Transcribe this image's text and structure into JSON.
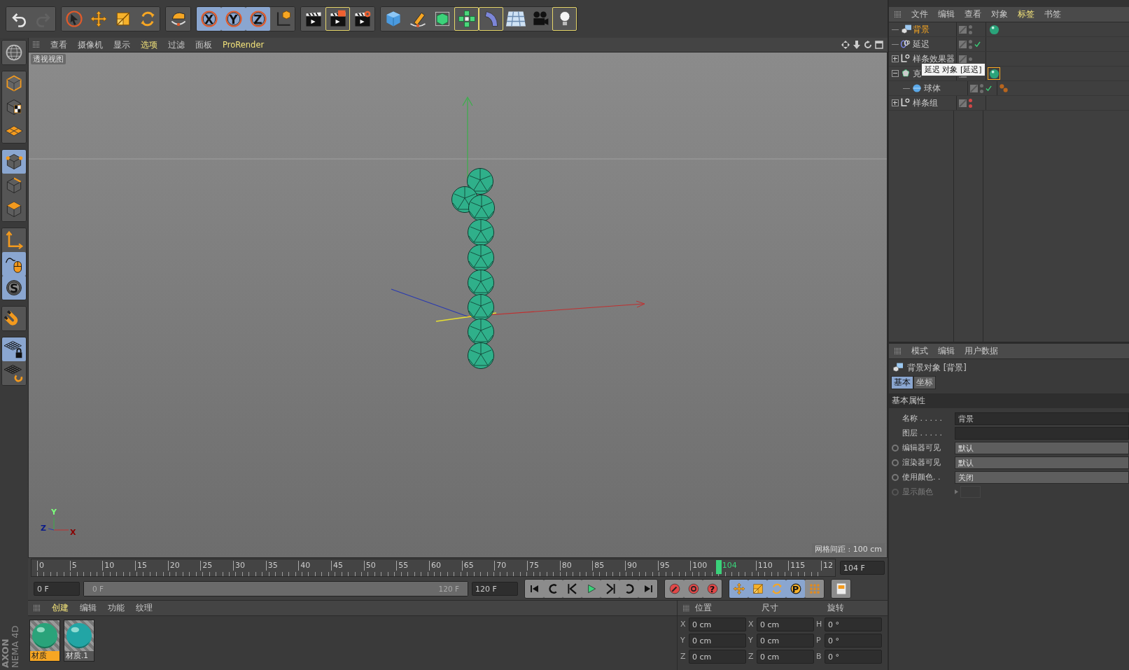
{
  "top_toolbar": [
    [
      {
        "active": false,
        "outlined": false,
        "disabled": false
      },
      {
        "active": false,
        "outlined": false,
        "disabled": true
      }
    ],
    [
      {
        "active": false,
        "outlined": false
      },
      {
        "active": false,
        "outlined": false
      },
      {
        "active": false,
        "outlined": false
      },
      {
        "active": false,
        "outlined": false
      }
    ],
    [
      {
        "active": false,
        "outlined": false
      }
    ],
    [
      {
        "active": true,
        "outlined": false,
        "label": "X"
      },
      {
        "active": true,
        "outlined": false,
        "label": "Y"
      },
      {
        "active": true,
        "outlined": false,
        "label": "Z"
      },
      {
        "active": false,
        "outlined": false
      }
    ],
    [
      {
        "active": false,
        "outlined": false
      },
      {
        "active": false,
        "outlined": true
      },
      {
        "active": false,
        "outlined": false
      }
    ],
    [
      {
        "active": false,
        "outlined": false
      },
      {
        "active": false,
        "outlined": false
      },
      {
        "active": false,
        "outlined": false
      },
      {
        "active": false,
        "outlined": true
      },
      {
        "active": false,
        "outlined": true
      },
      {
        "active": false,
        "outlined": false
      },
      {
        "active": false,
        "outlined": false
      },
      {
        "active": false,
        "outlined": true
      }
    ]
  ],
  "left_toolbar": [
    [
      {
        "active": false
      }
    ],
    [
      {
        "active": false
      },
      {
        "active": false
      },
      {
        "active": false
      }
    ],
    [
      {
        "active": true
      },
      {
        "active": false
      },
      {
        "active": false
      }
    ],
    [
      {
        "active": false
      },
      {
        "active": true
      },
      {
        "active": true,
        "label": "S"
      }
    ],
    [
      {
        "active": false
      }
    ],
    [
      {
        "active": true
      },
      {
        "active": false
      }
    ]
  ],
  "brand": [
    "AXON",
    "NEMA 4D"
  ],
  "viewport": {
    "menu": [
      {
        "label": "查看",
        "highlight": false
      },
      {
        "label": "摄像机",
        "highlight": false
      },
      {
        "label": "显示",
        "highlight": false
      },
      {
        "label": "选项",
        "highlight": true
      },
      {
        "label": "过滤",
        "highlight": false
      },
      {
        "label": "面板",
        "highlight": false
      },
      {
        "label": "ProRender",
        "highlight": true
      }
    ],
    "view_name": "透视视图",
    "grid_note": "网格间距 : 100 cm",
    "axis_labels": [
      "Y",
      "Z",
      "X"
    ]
  },
  "timeline": {
    "ticks": [
      "0",
      "5",
      "10",
      "15",
      "20",
      "25",
      "30",
      "35",
      "40",
      "45",
      "50",
      "55",
      "60",
      "65",
      "70",
      "75",
      "80",
      "85",
      "90",
      "95",
      "100"
    ],
    "ticks_after": [
      "110",
      "115",
      "12"
    ],
    "current": "104",
    "level": 0.8667,
    "frame_field": "104 F"
  },
  "playback": {
    "start_field": "0 F",
    "range": {
      "start": "0 F",
      "end": "120 F",
      "level": 1
    },
    "end_field": "120 F",
    "transport": [
      {
        "active": false
      },
      {
        "active": false
      },
      {
        "active": false
      },
      {
        "active": false
      },
      {
        "active": false
      },
      {
        "active": false
      },
      {
        "active": false
      }
    ],
    "keys": [
      {
        "active": false
      },
      {
        "active": false
      },
      {
        "active": false,
        "label": "?"
      }
    ],
    "key_modes": [
      {
        "active": true
      },
      {
        "active": true
      },
      {
        "active": true
      },
      {
        "active": true,
        "label": "P"
      },
      {
        "active": false
      }
    ],
    "layout": [
      {
        "active": false
      }
    ]
  },
  "materials": {
    "menu": [
      {
        "label": "创建",
        "highlight": true
      },
      {
        "label": "编辑",
        "highlight": false
      },
      {
        "label": "功能",
        "highlight": false
      },
      {
        "label": "纹理",
        "highlight": false
      }
    ],
    "items": [
      {
        "name": "材质",
        "selected": true,
        "color": "#2aa37a"
      },
      {
        "name": "材质.1",
        "selected": false,
        "color": "#22a5a5"
      }
    ]
  },
  "coordinates": {
    "headers": [
      "位置",
      "尺寸",
      "旋转"
    ],
    "rows": [
      {
        "a1": "X",
        "v1": "0 cm",
        "a2": "X",
        "v2": "0 cm",
        "a3": "H",
        "v3": "0 °"
      },
      {
        "a1": "Y",
        "v1": "0 cm",
        "a2": "Y",
        "v2": "0 cm",
        "a3": "P",
        "v3": "0 °"
      },
      {
        "a1": "Z",
        "v1": "0 cm",
        "a2": "Z",
        "v2": "0 cm",
        "a3": "B",
        "v3": "0 °"
      }
    ]
  },
  "object_manager": {
    "menu": [
      {
        "label": "文件",
        "highlight": false
      },
      {
        "label": "编辑",
        "highlight": false
      },
      {
        "label": "查看",
        "highlight": false
      },
      {
        "label": "对象",
        "highlight": false
      },
      {
        "label": "标签",
        "highlight": true
      },
      {
        "label": "书签",
        "highlight": false
      }
    ],
    "rows": [
      {
        "kind": "background",
        "name": "背景",
        "selected": true,
        "editor_off": false,
        "render_off": false,
        "enabled": false,
        "tags": [
          {
            "kind": "material",
            "selected": false
          }
        ]
      },
      {
        "kind": "delay",
        "name": "延迟",
        "selected": false,
        "editor_off": false,
        "render_off": false,
        "enabled": true,
        "tags": []
      },
      {
        "kind": "effector",
        "name": "样条效果器",
        "selected": false,
        "expanded": false,
        "editor_off": false,
        "enabled": false,
        "tags": []
      },
      {
        "kind": "cloner",
        "name": "克",
        "selected": false,
        "expanded": true,
        "enabled": false,
        "tags": [
          {
            "kind": "material",
            "selected": true
          }
        ],
        "children": [
          {
            "kind": "sphere",
            "name": "球体",
            "selected": false,
            "editor_off": false,
            "render_off": false,
            "enabled": true,
            "tags": [
              {
                "kind": "dots",
                "selected": false
              }
            ]
          }
        ]
      },
      {
        "kind": "spline",
        "name": "样条组",
        "selected": false,
        "expanded": false,
        "editor_off": true,
        "render_off": true,
        "enabled": false,
        "tags": []
      }
    ],
    "tooltip": "延迟 对象 [延迟]"
  },
  "attributes": {
    "menu": [
      {
        "label": "模式",
        "highlight": false
      },
      {
        "label": "编辑",
        "highlight": false
      },
      {
        "label": "用户数据",
        "highlight": false
      }
    ],
    "title": "背景对象 [背景]",
    "tabs": [
      {
        "label": "基本",
        "selected": true
      },
      {
        "label": "坐标",
        "selected": false
      }
    ],
    "section": "基本属性",
    "properties": [
      {
        "kind": "text",
        "label": "名称 . . . . .",
        "value": "背景",
        "disabled": false
      },
      {
        "kind": "text",
        "label": "图层 . . . . .",
        "disabled": false
      },
      {
        "kind": "dropdown",
        "label": "编辑器可见",
        "value": "默认",
        "disabled": false
      },
      {
        "kind": "dropdown",
        "label": "渲染器可见",
        "value": "默认",
        "disabled": false
      },
      {
        "kind": "dropdown",
        "label": "使用颜色. .",
        "value": "关闭",
        "disabled": false
      },
      {
        "kind": "color",
        "label": "显示颜色",
        "disabled": true
      }
    ]
  }
}
